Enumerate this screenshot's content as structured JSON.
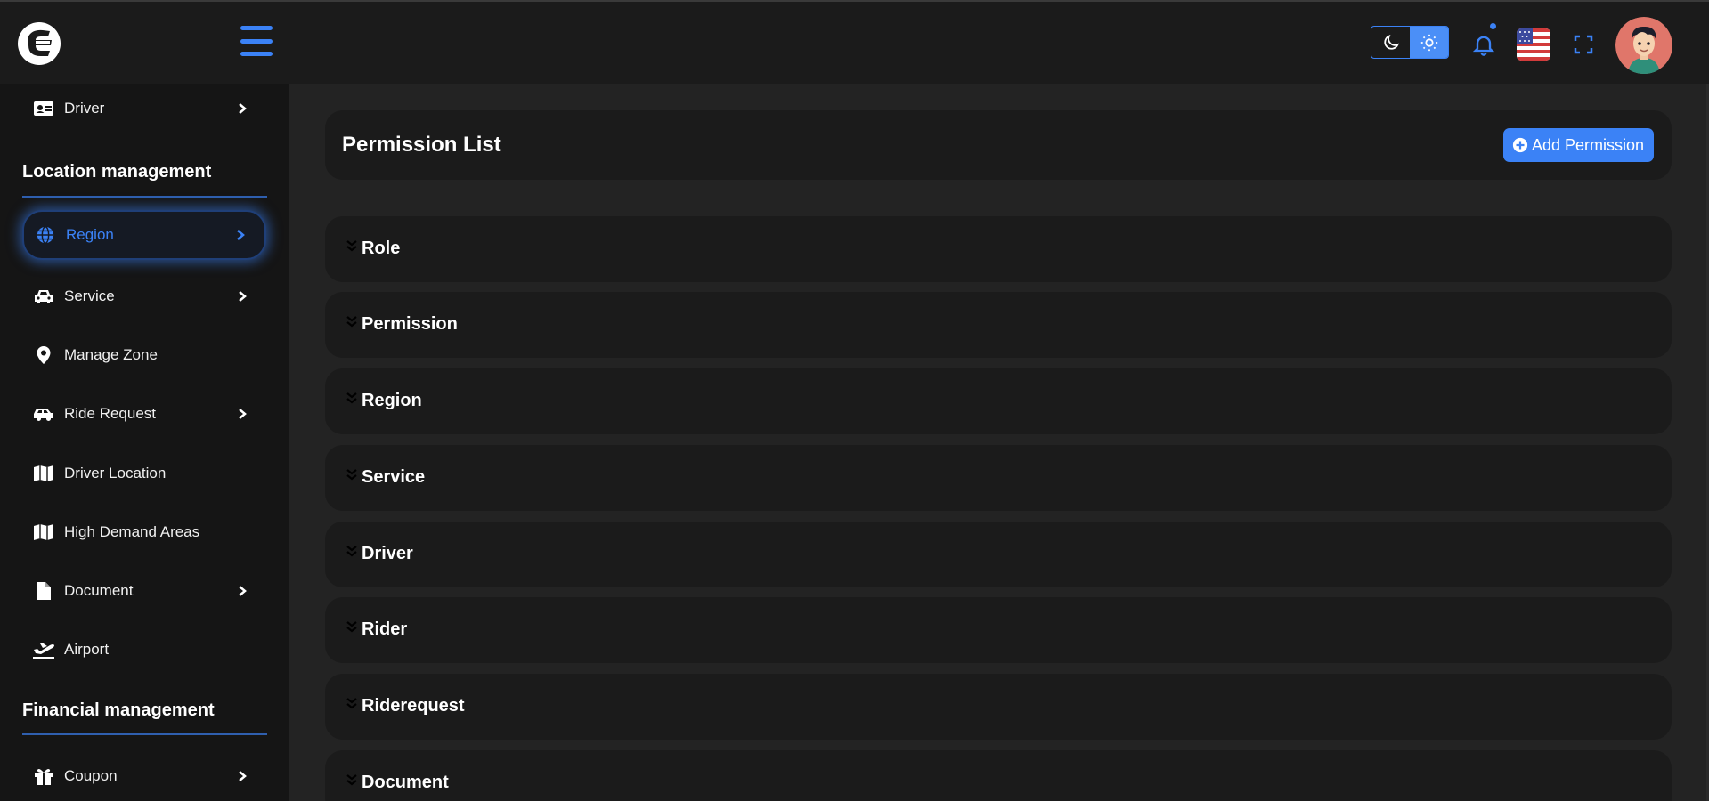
{
  "sidebar": {
    "items": [
      {
        "label": "Driver",
        "icon": "id-card-icon",
        "has_chevron": true
      },
      {
        "label": "Region",
        "icon": "globe-icon",
        "has_chevron": true,
        "active": true
      },
      {
        "label": "Service",
        "icon": "car-icon",
        "has_chevron": true
      },
      {
        "label": "Manage Zone",
        "icon": "map-pin-icon",
        "has_chevron": false
      },
      {
        "label": "Ride Request",
        "icon": "car-side-icon",
        "has_chevron": true
      },
      {
        "label": "Driver Location",
        "icon": "map-icon",
        "has_chevron": false
      },
      {
        "label": "High Demand Areas",
        "icon": "map-icon",
        "has_chevron": false
      },
      {
        "label": "Document",
        "icon": "file-icon",
        "has_chevron": true
      },
      {
        "label": "Airport",
        "icon": "plane-icon",
        "has_chevron": false
      },
      {
        "label": "Coupon",
        "icon": "gift-icon",
        "has_chevron": true
      }
    ],
    "sections": {
      "location": "Location management",
      "financial": "Financial management"
    }
  },
  "header": {
    "theme_modes": [
      "dark",
      "light"
    ],
    "selected_theme": "light",
    "notification_dot": true,
    "language_flag": "US"
  },
  "main": {
    "page_title": "Permission List",
    "add_button_label": "Add Permission",
    "accordions": [
      "Role",
      "Permission",
      "Region",
      "Service",
      "Driver",
      "Rider",
      "Riderequest",
      "Document"
    ]
  },
  "colors": {
    "accent": "#3b82f6",
    "page_bg": "#232323",
    "card_bg": "#1b1b1b",
    "sidebar_bg": "#151515"
  }
}
